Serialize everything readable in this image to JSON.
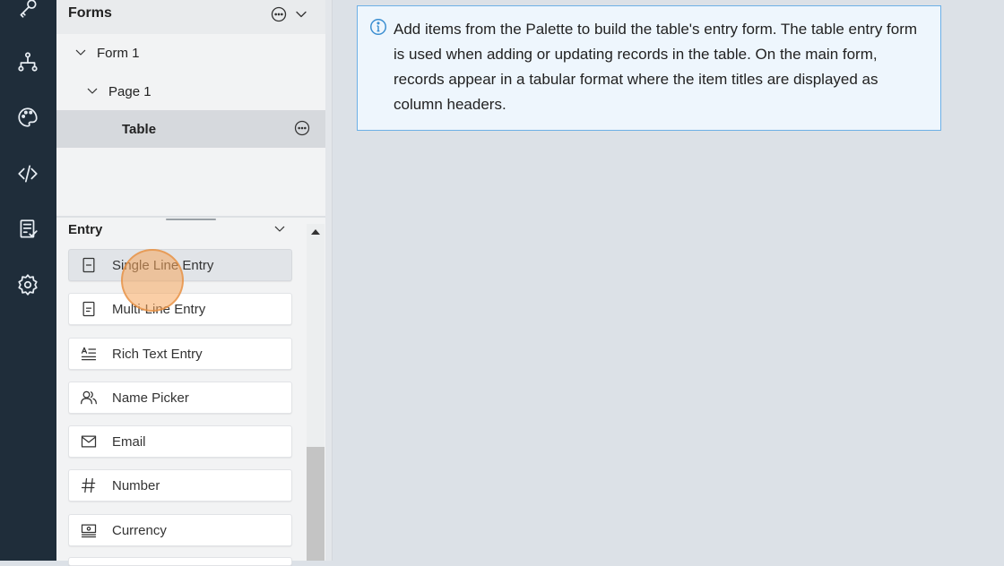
{
  "rail": {
    "icons": [
      "key-icon",
      "hierarchy-icon",
      "palette-icon",
      "code-icon",
      "checklist-icon",
      "settings-gear-icon"
    ]
  },
  "forms_panel": {
    "title": "Forms",
    "tree": [
      {
        "label": "Form 1",
        "level": 1,
        "expanded": true
      },
      {
        "label": "Page 1",
        "level": 2,
        "expanded": true
      },
      {
        "label": "Table",
        "level": 3,
        "selected": true
      }
    ]
  },
  "palette": {
    "section_title": "Entry",
    "items": [
      {
        "label": "Single Line Entry",
        "icon": "single-line-entry-icon"
      },
      {
        "label": "Multi-Line Entry",
        "icon": "multi-line-entry-icon"
      },
      {
        "label": "Rich Text Entry",
        "icon": "rich-text-entry-icon"
      },
      {
        "label": "Name Picker",
        "icon": "name-picker-icon"
      },
      {
        "label": "Email",
        "icon": "email-icon"
      },
      {
        "label": "Number",
        "icon": "number-hash-icon"
      },
      {
        "label": "Currency",
        "icon": "currency-icon"
      }
    ]
  },
  "info": {
    "text": "Add items from the Palette to build the table's entry form. The table entry form is used when adding or updating records in the table. On the main form, records appear in a tabular format where the item titles are displayed as column headers."
  },
  "colors": {
    "rail_bg": "#1f2d3a",
    "canvas_bg": "#dce1e7",
    "info_border": "#6db0e6",
    "info_bg": "#eef6fd"
  }
}
